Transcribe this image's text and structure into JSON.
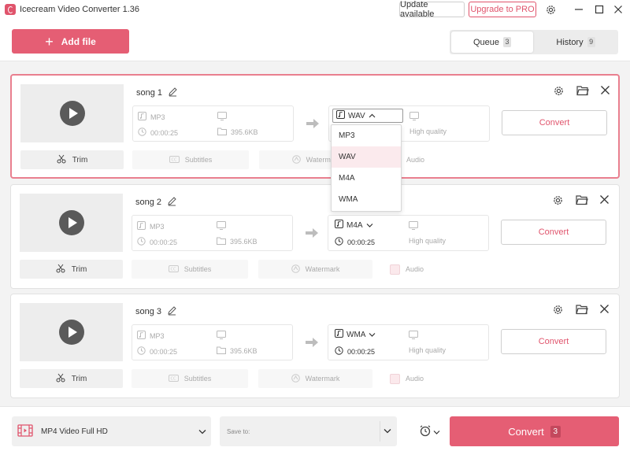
{
  "app": {
    "title": "Icecream Video Converter 1.36",
    "update_label": "Update available",
    "pro_label": "Upgrade to PRO",
    "accent": "#e55e74"
  },
  "toolbar": {
    "add_file_label": "Add file",
    "tabs": [
      {
        "label": "Queue",
        "count": "3",
        "active": true
      },
      {
        "label": "History",
        "count": "9",
        "active": false
      }
    ]
  },
  "queue": [
    {
      "title": "song 1",
      "source": {
        "format": "MP3",
        "duration": "00:00:25",
        "size": "395.6KB"
      },
      "output": {
        "format": "WAV",
        "quality": "High quality"
      },
      "convert_label": "Convert",
      "trim_label": "Trim",
      "subtitles_label": "Subtitles",
      "watermark_label": "Watermark",
      "audio_label": "Audio"
    },
    {
      "title": "song 2",
      "source": {
        "format": "MP3",
        "duration": "00:00:25",
        "size": "395.6KB"
      },
      "output": {
        "format": "M4A",
        "duration": "00:00:25",
        "quality": "High quality"
      },
      "convert_label": "Convert",
      "trim_label": "Trim",
      "subtitles_label": "Subtitles",
      "watermark_label": "Watermark",
      "audio_label": "Audio"
    },
    {
      "title": "song 3",
      "source": {
        "format": "MP3",
        "duration": "00:00:25",
        "size": "395.6KB"
      },
      "output": {
        "format": "WMA",
        "duration": "00:00:25",
        "quality": "High quality"
      },
      "convert_label": "Convert",
      "trim_label": "Trim",
      "subtitles_label": "Subtitles",
      "watermark_label": "Watermark",
      "audio_label": "Audio"
    }
  ],
  "format_dropdown": {
    "options": [
      "MP3",
      "WAV",
      "M4A",
      "WMA"
    ],
    "selected": "WAV"
  },
  "footer": {
    "preset_label": "MP4 Video Full HD",
    "save_to_label": "Save to:",
    "convert_label": "Convert",
    "convert_count": "3"
  }
}
